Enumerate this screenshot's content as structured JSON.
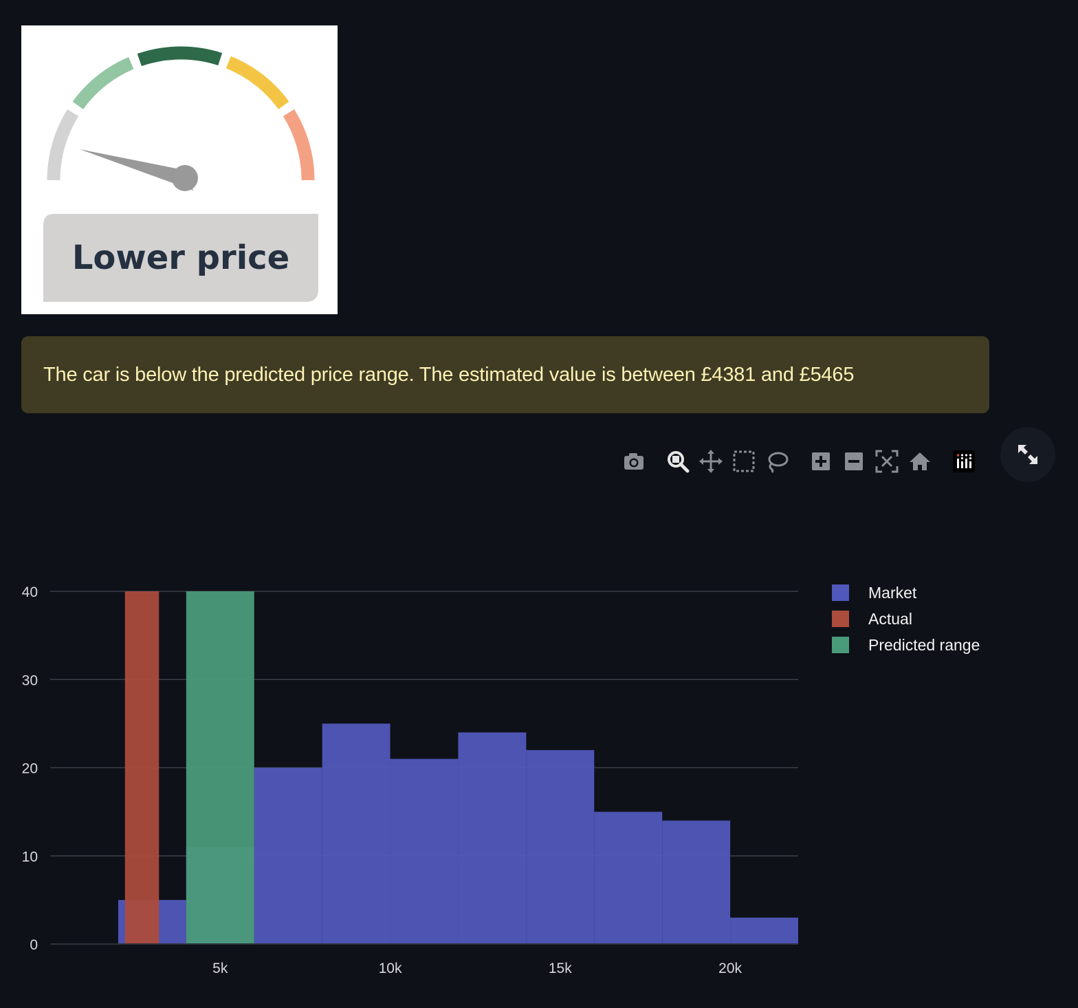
{
  "gauge": {
    "label": "Lower price",
    "level": "lower",
    "segment_colors": [
      "#d3d3d3",
      "#93c6a3",
      "#2e6a4a",
      "#f4c545",
      "#f4a183"
    ],
    "needle_color": "#999999",
    "label_bg": "#d3d2d1",
    "label_color": "#253040"
  },
  "alert": {
    "message": "The car is below the predicted price range. The estimated value is between £4381 and £5465"
  },
  "modebar": {
    "buttons": [
      {
        "name": "camera-icon",
        "title": "Download plot as a png"
      },
      {
        "name": "zoom-icon",
        "title": "Zoom"
      },
      {
        "name": "pan-icon",
        "title": "Pan"
      },
      {
        "name": "box-select-icon",
        "title": "Box Select"
      },
      {
        "name": "lasso-select-icon",
        "title": "Lasso Select"
      },
      {
        "name": "zoom-in-icon",
        "title": "Zoom in"
      },
      {
        "name": "zoom-out-icon",
        "title": "Zoom out"
      },
      {
        "name": "autoscale-icon",
        "title": "Autoscale"
      },
      {
        "name": "reset-axes-icon",
        "title": "Reset axes"
      },
      {
        "name": "plotly-logo-icon",
        "title": "Produced with Plotly"
      }
    ],
    "fullscreen_icon": "expand-icon"
  },
  "chart_data": {
    "type": "bar",
    "barmode": "overlay",
    "xlim": [
      0,
      22000
    ],
    "ylim": [
      0,
      40
    ],
    "x_ticks": [
      5000,
      10000,
      15000,
      20000
    ],
    "x_tick_labels": [
      "5k",
      "10k",
      "15k",
      "20k"
    ],
    "y_ticks": [
      0,
      10,
      20,
      30,
      40
    ],
    "y_tick_labels": [
      "0",
      "10",
      "20",
      "30",
      "40"
    ],
    "grid": true,
    "legend_position": "top-right",
    "series": [
      {
        "name": "Market",
        "color": "#5158bb",
        "bins": [
          {
            "x0": 2000,
            "x1": 4000,
            "y": 5
          },
          {
            "x0": 4000,
            "x1": 6000,
            "y": 11
          },
          {
            "x0": 6000,
            "x1": 8000,
            "y": 20
          },
          {
            "x0": 8000,
            "x1": 10000,
            "y": 25
          },
          {
            "x0": 10000,
            "x1": 12000,
            "y": 21
          },
          {
            "x0": 12000,
            "x1": 14000,
            "y": 24
          },
          {
            "x0": 14000,
            "x1": 16000,
            "y": 22
          },
          {
            "x0": 16000,
            "x1": 18000,
            "y": 15
          },
          {
            "x0": 18000,
            "x1": 20000,
            "y": 14
          },
          {
            "x0": 20000,
            "x1": 22000,
            "y": 3
          }
        ]
      },
      {
        "name": "Actual",
        "color": "#ab4c3d",
        "bins": [
          {
            "x0": 2200,
            "x1": 3200,
            "y": 40
          }
        ]
      },
      {
        "name": "Predicted range",
        "color": "#4a9b7a",
        "bins": [
          {
            "x0": 4000,
            "x1": 6000,
            "y": 40
          }
        ]
      }
    ]
  }
}
